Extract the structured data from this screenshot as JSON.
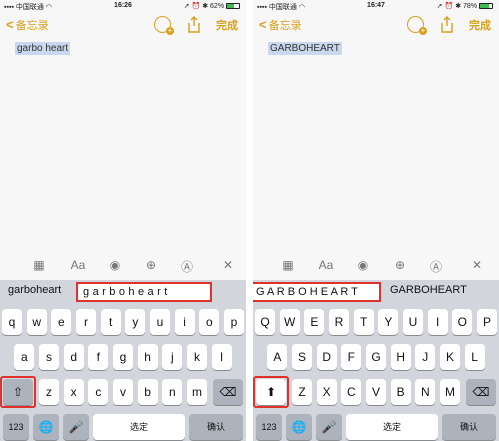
{
  "left": {
    "status": {
      "carrier": "中国联通",
      "time": "16:26",
      "battery": "62%",
      "battery_fill": 0.62
    },
    "nav": {
      "back_label": "备忘录",
      "done_label": "完成"
    },
    "note_text": "garbo heart",
    "prediction": {
      "plain": "garboheart",
      "boxed": "g a r b o h e a r t"
    },
    "keyboard": {
      "row1": [
        "q",
        "w",
        "e",
        "r",
        "t",
        "y",
        "u",
        "i",
        "o",
        "p"
      ],
      "row2": [
        "a",
        "s",
        "d",
        "f",
        "g",
        "h",
        "j",
        "k",
        "l"
      ],
      "row3": [
        "z",
        "x",
        "c",
        "v",
        "b",
        "n",
        "m"
      ],
      "num_key": "123",
      "space_key": "选定",
      "return_key": "确认"
    }
  },
  "right": {
    "status": {
      "carrier": "中国联通",
      "time": "16:47",
      "battery": "78%",
      "battery_fill": 0.78
    },
    "nav": {
      "back_label": "备忘录",
      "done_label": "完成"
    },
    "note_text": "GARBOHEART",
    "prediction": {
      "boxed": "G A R B O H E A R T",
      "plain": "GARBOHEART"
    },
    "keyboard": {
      "row1": [
        "Q",
        "W",
        "E",
        "R",
        "T",
        "Y",
        "U",
        "I",
        "O",
        "P"
      ],
      "row2": [
        "A",
        "S",
        "D",
        "F",
        "G",
        "H",
        "J",
        "K",
        "L"
      ],
      "row3": [
        "Z",
        "X",
        "C",
        "V",
        "B",
        "N",
        "M"
      ],
      "num_key": "123",
      "space_key": "选定",
      "return_key": "确认"
    }
  },
  "toolbar": {
    "format_label": "Aa"
  },
  "icons": [
    "table-icon",
    "format-icon",
    "checklist-icon",
    "add-icon",
    "markup-icon",
    "close-icon",
    "collapse-icon",
    "shift-icon",
    "shift-filled-icon",
    "backspace-icon",
    "globe-icon",
    "mic-icon",
    "share-icon",
    "people-icon",
    "signal-icon",
    "wifi-icon",
    "location-icon",
    "alarm-icon",
    "bluetooth-icon",
    "battery-icon"
  ],
  "colors": {
    "accent": "#d6a11c",
    "highlight": "#e0312b",
    "keyboard_bg": "#d2d5db",
    "key": "#ffffff",
    "key_gray": "#adb3bc",
    "selection": "#c9d8ee"
  }
}
